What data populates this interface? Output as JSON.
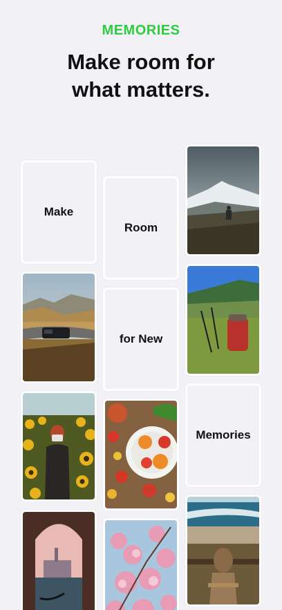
{
  "header": {
    "eyebrow": "MEMORIES",
    "headline_line1": "Make room for",
    "headline_line2": "what matters."
  },
  "cards": {
    "make": "Make",
    "room": "Room",
    "for_new": "for New",
    "memories": "Memories"
  },
  "photos": [
    "mountain-hiker-photo",
    "campervan-valley-photo",
    "backpack-trekking-poles-photo",
    "sunflower-field-camera-photo",
    "tomato-salad-plate-photo",
    "venice-gondola-archway-photo",
    "cherry-blossom-photo",
    "seaside-woman-chair-photo"
  ],
  "colors": {
    "accent": "#2ecc40",
    "background": "#f2f2f6",
    "text": "#111111"
  }
}
